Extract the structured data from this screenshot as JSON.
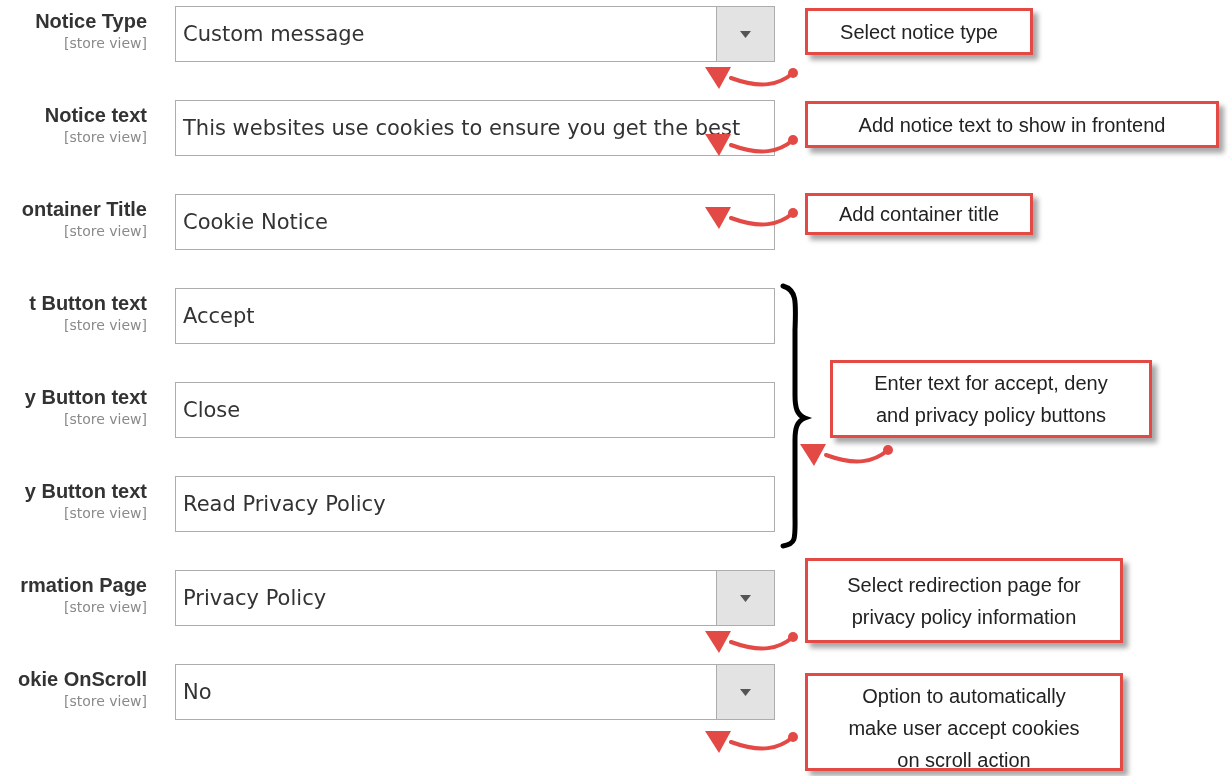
{
  "fields": [
    {
      "label": "Notice Type",
      "scope": "[store view]",
      "kind": "select",
      "value": "Custom message"
    },
    {
      "label": "Notice text",
      "scope": "[store view]",
      "kind": "text",
      "value": "This websites use cookies to ensure you get the best"
    },
    {
      "label": "ontainer Title",
      "scope": "[store view]",
      "kind": "text",
      "value": "Cookie Notice"
    },
    {
      "label": "t Button text",
      "scope": "[store view]",
      "kind": "text",
      "value": "Accept"
    },
    {
      "label": "y Button text",
      "scope": "[store view]",
      "kind": "text",
      "value": "Close"
    },
    {
      "label": "y Button text",
      "scope": "[store view]",
      "kind": "text",
      "value": "Read Privacy Policy"
    },
    {
      "label": "rmation Page",
      "scope": "[store view]",
      "kind": "select",
      "value": "Privacy Policy"
    },
    {
      "label": "okie OnScroll",
      "scope": "[store view]",
      "kind": "select",
      "value": "No"
    }
  ],
  "annotations": [
    {
      "text": "Select notice type"
    },
    {
      "text": "Add notice text to show in frontend"
    },
    {
      "text": "Add container title"
    },
    {
      "text": "Enter text for accept, deny\nand privacy policy buttons"
    },
    {
      "text": "Select redirection page for\nprivacy policy information"
    },
    {
      "text": "Option to automatically\nmake user accept cookies\non scroll action"
    }
  ]
}
